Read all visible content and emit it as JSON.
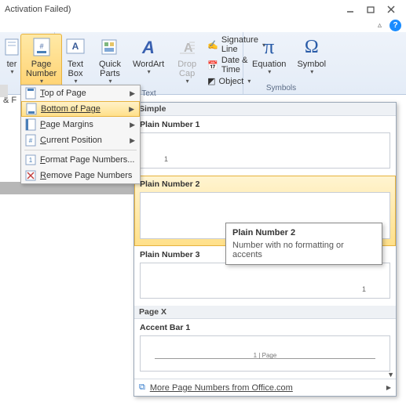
{
  "window": {
    "title": "Activation Failed)"
  },
  "ribbon": {
    "header_btn": "ter",
    "page_number": "Page\nNumber",
    "text_box": "Text\nBox",
    "quick_parts": "Quick\nParts",
    "wordart": "WordArt",
    "drop_cap": "Drop\nCap",
    "sig_line": "Signature Line",
    "date_time": "Date & Time",
    "object": "Object",
    "equation": "Equation",
    "symbol": "Symbol",
    "group_text": "Text",
    "group_symbols": "Symbols"
  },
  "frag": {
    "label": "& F"
  },
  "menu": {
    "top": "Top of Page",
    "bottom": "Bottom of Page",
    "margins": "Page Margins",
    "current": "Current Position",
    "format": "Format Page Numbers...",
    "remove": "Remove Page Numbers",
    "accel": {
      "top": "T",
      "bottom": "B",
      "margins": "P",
      "current": "C",
      "format": "F",
      "remove": "R"
    }
  },
  "gallery": {
    "header_simple": "Simple",
    "items": [
      {
        "name": "Plain Number 1",
        "align": "left"
      },
      {
        "name": "Plain Number 2",
        "align": "center"
      },
      {
        "name": "Plain Number 3",
        "align": "right"
      }
    ],
    "header_pagex": "Page X",
    "pagex_item": "Accent Bar 1",
    "pagex_sample": "1 | Page",
    "footer": "More Page Numbers from Office.com"
  },
  "tooltip": {
    "title": "Plain Number 2",
    "body": "Number with no formatting or accents"
  }
}
